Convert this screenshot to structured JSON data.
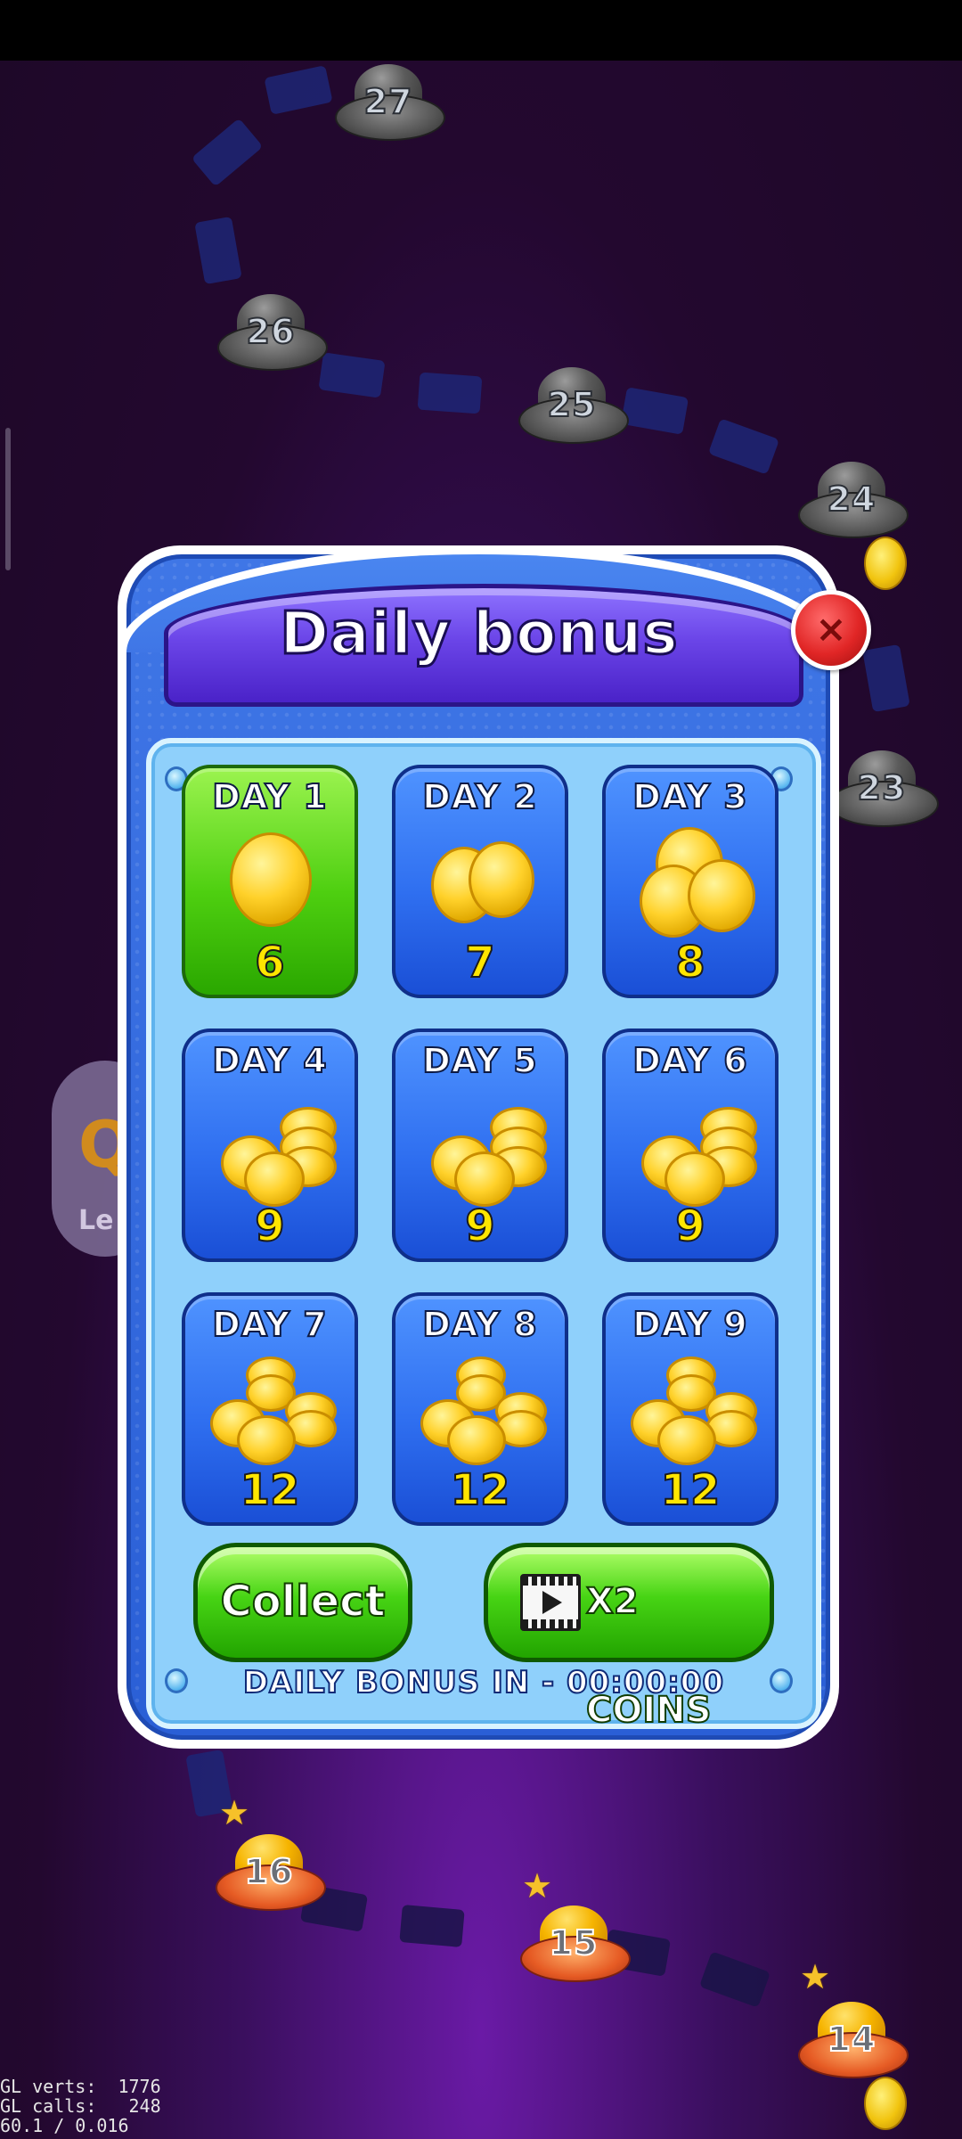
{
  "map": {
    "levels_locked": [
      "27",
      "26",
      "25",
      "24",
      "23"
    ],
    "levels_completed": [
      "16",
      "15",
      "14"
    ],
    "side_button": {
      "icon": "Q",
      "label": "Le"
    }
  },
  "dialog": {
    "title": "Daily bonus",
    "close_icon": "×",
    "days": [
      {
        "label": "DAY 1",
        "amount": "6",
        "active": true
      },
      {
        "label": "DAY 2",
        "amount": "7",
        "active": false
      },
      {
        "label": "DAY 3",
        "amount": "8",
        "active": false
      },
      {
        "label": "DAY 4",
        "amount": "9",
        "active": false
      },
      {
        "label": "DAY 5",
        "amount": "9",
        "active": false
      },
      {
        "label": "DAY 6",
        "amount": "9",
        "active": false
      },
      {
        "label": "DAY 7",
        "amount": "12",
        "active": false
      },
      {
        "label": "DAY 8",
        "amount": "12",
        "active": false
      },
      {
        "label": "DAY 9",
        "amount": "12",
        "active": false
      }
    ],
    "collect_label": "Collect",
    "x2_label": "X2 COINS",
    "timer": "DAILY BONUS IN - 00:00:00"
  },
  "debug": {
    "line1": "GL verts:  1776",
    "line2": "GL calls:   248",
    "line3": "60.1 / 0.016"
  },
  "colors": {
    "active_card": "#4ecf10",
    "card": "#2f6ff0",
    "title_band": "#6b45e8",
    "close": "#e12626",
    "button": "#47d414"
  }
}
